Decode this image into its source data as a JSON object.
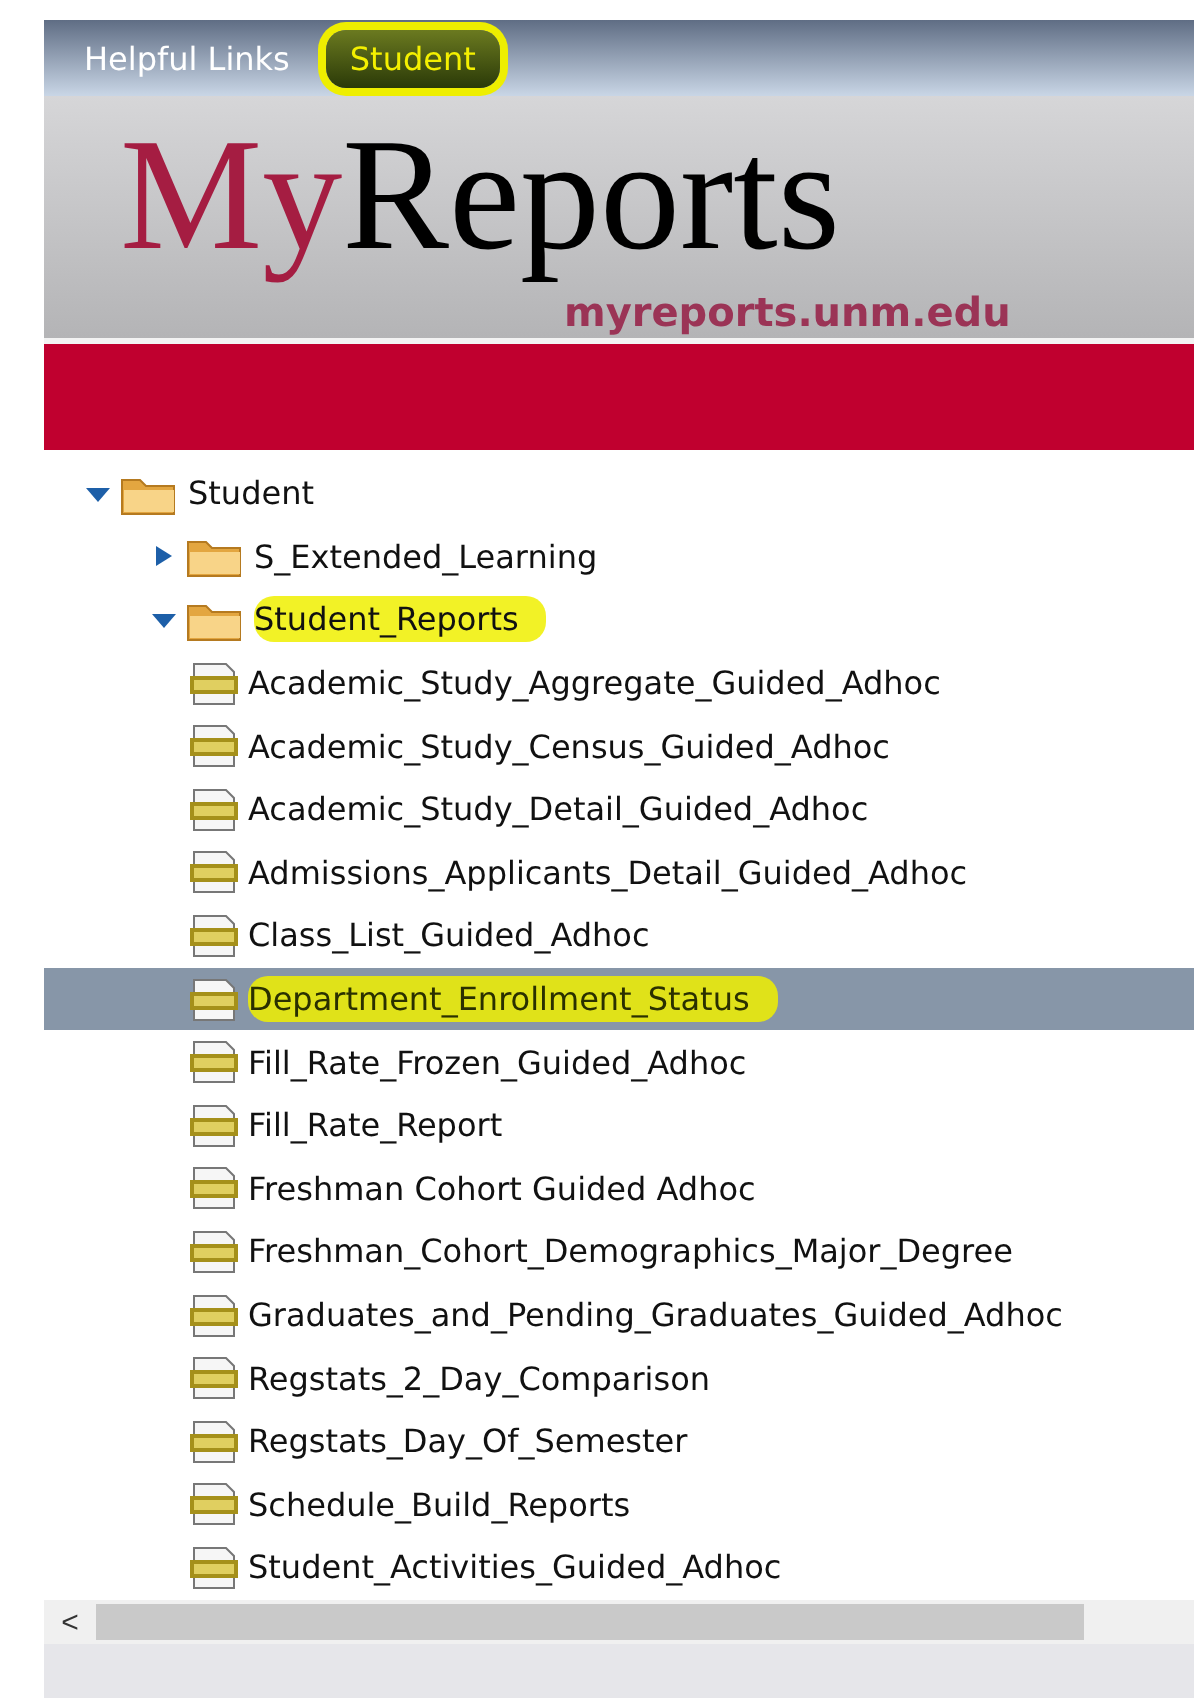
{
  "tabs": [
    {
      "label": "Helpful Links",
      "selected": false,
      "highlighted": false
    },
    {
      "label": "Student",
      "selected": true,
      "highlighted": true
    }
  ],
  "logo": {
    "part_1": "My",
    "part_2": "Reports",
    "url": "myreports.unm.edu"
  },
  "tree": [
    {
      "label": "Student",
      "kind": "folder",
      "expanded": true,
      "highlighted": false,
      "children": [
        {
          "label": "S_Extended_Learning",
          "kind": "folder",
          "expanded": false,
          "highlighted": false
        },
        {
          "label": "Student_Reports",
          "kind": "folder",
          "expanded": true,
          "highlighted": true,
          "children": [
            {
              "label": "Academic_Study_Aggregate_Guided_Adhoc",
              "kind": "report",
              "selected": false,
              "highlighted": false
            },
            {
              "label": "Academic_Study_Census_Guided_Adhoc",
              "kind": "report",
              "selected": false,
              "highlighted": false
            },
            {
              "label": "Academic_Study_Detail_Guided_Adhoc",
              "kind": "report",
              "selected": false,
              "highlighted": false
            },
            {
              "label": "Admissions_Applicants_Detail_Guided_Adhoc",
              "kind": "report",
              "selected": false,
              "highlighted": false
            },
            {
              "label": "Class_List_Guided_Adhoc",
              "kind": "report",
              "selected": false,
              "highlighted": false
            },
            {
              "label": "Department_Enrollment_Status",
              "kind": "report",
              "selected": true,
              "highlighted": true
            },
            {
              "label": "Fill_Rate_Frozen_Guided_Adhoc",
              "kind": "report",
              "selected": false,
              "highlighted": false
            },
            {
              "label": "Fill_Rate_Report",
              "kind": "report",
              "selected": false,
              "highlighted": false
            },
            {
              "label": "Freshman Cohort Guided Adhoc",
              "kind": "report",
              "selected": false,
              "highlighted": false
            },
            {
              "label": "Freshman_Cohort_Demographics_Major_Degree",
              "kind": "report",
              "selected": false,
              "highlighted": false
            },
            {
              "label": "Graduates_and_Pending_Graduates_Guided_Adhoc",
              "kind": "report",
              "selected": false,
              "highlighted": false
            },
            {
              "label": "Regstats_2_Day_Comparison",
              "kind": "report",
              "selected": false,
              "highlighted": false
            },
            {
              "label": "Regstats_Day_Of_Semester",
              "kind": "report",
              "selected": false,
              "highlighted": false
            },
            {
              "label": "Schedule_Build_Reports",
              "kind": "report",
              "selected": false,
              "highlighted": false
            },
            {
              "label": "Student_Activities_Guided_Adhoc",
              "kind": "report",
              "selected": false,
              "highlighted": false
            }
          ]
        }
      ]
    }
  ],
  "scrollbar": {
    "arrow": "<"
  }
}
